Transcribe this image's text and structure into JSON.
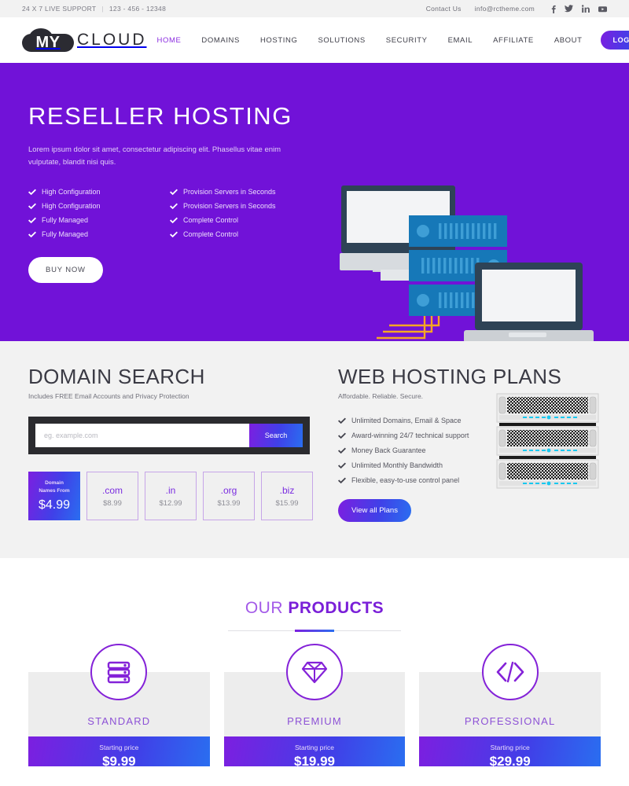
{
  "topbar": {
    "support_text": "24 X 7 LIVE SUPPORT",
    "separator": "|",
    "phone": "123 - 456 - 12348",
    "contact_label": "Contact Us",
    "email": "info@rctheme.com",
    "socials": [
      "facebook-icon",
      "twitter-icon",
      "linkedin-icon",
      "youtube-icon"
    ]
  },
  "header": {
    "logo_primary": "MY",
    "logo_secondary": "CLOUD",
    "nav": [
      {
        "label": "HOME",
        "active": true
      },
      {
        "label": "DOMAINS",
        "active": false
      },
      {
        "label": "HOSTING",
        "active": false
      },
      {
        "label": "SOLUTIONS",
        "active": false
      },
      {
        "label": "SECURITY",
        "active": false
      },
      {
        "label": "EMAIL",
        "active": false
      },
      {
        "label": "AFFILIATE",
        "active": false
      },
      {
        "label": "ABOUT",
        "active": false
      }
    ],
    "login_label": "LOGIN"
  },
  "hero": {
    "title": "RESELLER HOSTING",
    "subtitle": "Lorem ipsum dolor sit amet, consectetur adipiscing elit. Phasellus vitae enim vulputate, blandit nisi quis.",
    "features": [
      "High Configuration",
      "Provision Servers in Seconds",
      "High Configuration",
      "Provision Servers in Seconds",
      "Fully Managed",
      "Complete Control",
      "Fully Managed",
      "Complete Control"
    ],
    "cta_label": "BUY NOW",
    "background_color": "#7112d8",
    "illustration": "servers-monitor-laptop-illustration"
  },
  "domain_search": {
    "title": "DOMAIN SEARCH",
    "subtitle": "Includes FREE Email Accounts and Privacy Protection",
    "input_placeholder": "eg. example.com",
    "input_value": "",
    "search_label": "Search",
    "featured_tld": {
      "lead_line1": "Domain",
      "lead_line2": "Names From",
      "price": "$4.99"
    },
    "tlds": [
      {
        "name": ".com",
        "price": "$8.99"
      },
      {
        "name": ".in",
        "price": "$12.99"
      },
      {
        "name": ".org",
        "price": "$13.99"
      },
      {
        "name": ".biz",
        "price": "$15.99"
      }
    ]
  },
  "hosting_plans": {
    "title": "WEB HOSTING PLANS",
    "subtitle": "Affordable. Reliable. Secure.",
    "features": [
      "Unlimited Domains, Email & Space",
      "Award-winning 24/7 technical support",
      "Money Back Guarantee",
      "Unlimited Monthly Bandwidth",
      "Flexible, easy-to-use control panel"
    ],
    "cta_label": "View all Plans",
    "server_image": "server-rack-stack-image"
  },
  "products": {
    "heading_light": "OUR ",
    "heading_bold": "PRODUCTS",
    "cards": [
      {
        "name": "STANDARD",
        "icon": "server-rack-icon",
        "price_label": "Starting price",
        "price": "$9.99"
      },
      {
        "name": "PREMIUM",
        "icon": "diamond-icon",
        "price_label": "Starting price",
        "price": "$19.99"
      },
      {
        "name": "PROFESSIONAL",
        "icon": "code-brackets-icon",
        "price_label": "Starting price",
        "price": "$29.99"
      }
    ]
  },
  "theme": {
    "accent_purple": "#7112d8",
    "accent_blue": "#2a6ef0",
    "hero_text": "#ffffff"
  }
}
